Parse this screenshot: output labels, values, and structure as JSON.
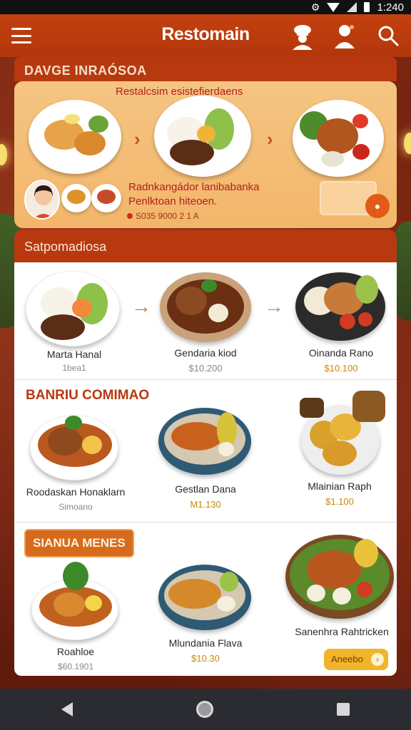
{
  "status_bar": {
    "time": "1:240"
  },
  "app_bar": {
    "title": "Restomain"
  },
  "promo": {
    "label": "DAVGE INRAÓSOA",
    "subtitle": "Restalcsim esistefierdaens",
    "line1": "Radnkangádor lanibabanka",
    "line2": "Penlktoan hiteoen.",
    "code": "S035 9000 2 1 A"
  },
  "menu": {
    "header": "Satpomadiosa",
    "row1": [
      {
        "name": "Marta Hanal",
        "price": "1bea1",
        "price_color": "#888888"
      },
      {
        "name": "Gendaria kiod",
        "price": "$10.200",
        "price_color": "#888888"
      },
      {
        "name": "Oinanda Rano",
        "price": "$10.100",
        "price_color": "#c78a05"
      }
    ],
    "section2_title": "BANRIU COMIMAO",
    "row2": [
      {
        "name": "Roodaskan Honaklarn",
        "price": "Simoano",
        "price_color": "#888888"
      },
      {
        "name": "Gestlan Dana",
        "price": "M1.130",
        "price_color": "#c78a05"
      },
      {
        "name": "Mlainian Raph",
        "price": "$1.100",
        "price_color": "#c78a05"
      }
    ],
    "section3_title": "SIANUA MENES",
    "row3": [
      {
        "name": "Roahloe",
        "price": "$60.1901",
        "price_color": "#888888"
      },
      {
        "name": "Mlundania Flava",
        "price": "$10.30",
        "price_color": "#c78a05"
      },
      {
        "name": "Sanenhra Rahtricken",
        "price": "",
        "price_color": "#888888"
      }
    ],
    "more_label": "Aneebo"
  }
}
